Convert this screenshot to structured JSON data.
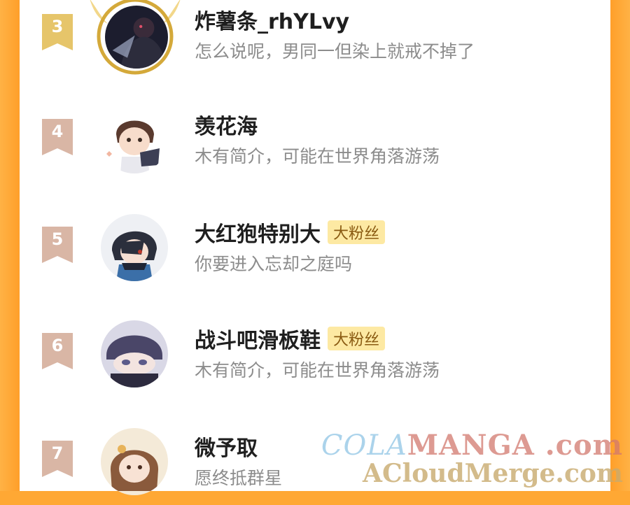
{
  "rows": [
    {
      "rank": "3",
      "name": "炸薯条_rhYLvy",
      "bio": "怎么说呢，男同一但染上就戒不掉了",
      "tag": "",
      "badge_color": "#e6c56a"
    },
    {
      "rank": "4",
      "name": "羡花海",
      "bio": "木有简介，可能在世界角落游荡",
      "tag": "",
      "badge_color": "#d9b6a5"
    },
    {
      "rank": "5",
      "name": "大红狍特别大",
      "bio": "你要进入忘却之庭吗",
      "tag": "大粉丝",
      "badge_color": "#d9b6a5"
    },
    {
      "rank": "6",
      "name": "战斗吧滑板鞋",
      "bio": "木有简介，可能在世界角落游荡",
      "tag": "大粉丝",
      "badge_color": "#d9b6a5"
    },
    {
      "rank": "7",
      "name": "微予取",
      "bio": "愿终抵群星",
      "tag": "",
      "badge_color": "#d9b6a5"
    }
  ],
  "watermark": {
    "line1_a": "COLA",
    "line1_b": "MANGA .com",
    "line2": "ACloudMerge.com"
  },
  "colors": {
    "side_orange": "#ff9f2a",
    "tag_bg": "#fde9a3",
    "name": "#1f1f1f",
    "bio": "#8c8c8c"
  }
}
